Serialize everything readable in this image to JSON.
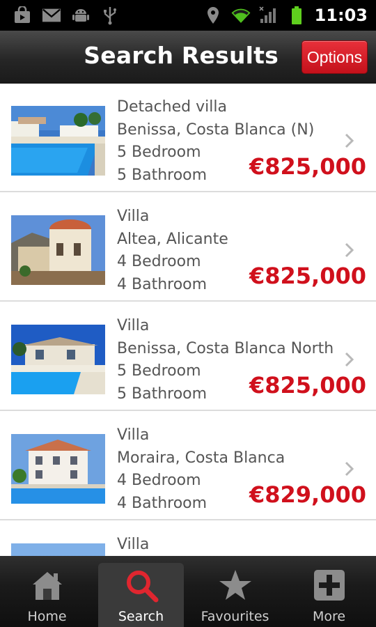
{
  "status_bar": {
    "time": "11:03",
    "left_icons": [
      "bag-icon",
      "mail-icon",
      "android-icon",
      "usb-icon"
    ],
    "right_icons": [
      "location-icon",
      "wifi-icon",
      "signal-icon",
      "battery-icon"
    ]
  },
  "header": {
    "title": "Search Results",
    "options_label": "Options"
  },
  "results": [
    {
      "type": "Detached villa",
      "location": "Benissa, Costa Blanca (N)",
      "bedrooms": "5 Bedroom",
      "bathrooms": "5 Bathroom",
      "price": "€825,000"
    },
    {
      "type": "Villa",
      "location": "Altea, Alicante",
      "bedrooms": "4 Bedroom",
      "bathrooms": "4 Bathroom",
      "price": "€825,000"
    },
    {
      "type": "Villa",
      "location": "Benissa, Costa Blanca North",
      "bedrooms": "5 Bedroom",
      "bathrooms": "5 Bathroom",
      "price": "€825,000"
    },
    {
      "type": "Villa",
      "location": "Moraira, Costa Blanca",
      "bedrooms": "4 Bedroom",
      "bathrooms": "4 Bathroom",
      "price": "€829,000"
    },
    {
      "type": "Villa",
      "location": "",
      "bedrooms": "",
      "bathrooms": "",
      "price": ""
    }
  ],
  "bottom_nav": [
    {
      "label": "Home",
      "icon": "home-icon",
      "active": false
    },
    {
      "label": "Search",
      "icon": "search-icon",
      "active": true
    },
    {
      "label": "Favourites",
      "icon": "star-icon",
      "active": false
    },
    {
      "label": "More",
      "icon": "plus-icon",
      "active": false
    }
  ],
  "colors": {
    "accent_red": "#d0101c",
    "header_bg": "#262626",
    "text_gray": "#555555"
  }
}
